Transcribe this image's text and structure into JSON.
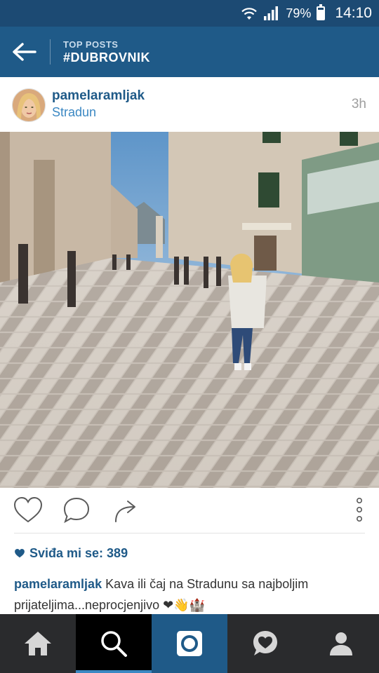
{
  "status_bar": {
    "battery": "79%",
    "battery_level": 0.79,
    "time": "14:10"
  },
  "header": {
    "subtitle": "TOP POSTS",
    "title": "#DUBROVNIK"
  },
  "post": {
    "username": "pamelaramljak",
    "location": "Stradun",
    "time_ago": "3h",
    "likes": "Sviđa mi se: 389",
    "caption_user": "pamelaramljak",
    "caption_text": " Kava ili čaj na Stradunu sa najboljim prijateljima...neprocjenjivo ❤👋🏰"
  },
  "tabs": [
    "home",
    "search",
    "camera",
    "activity",
    "profile"
  ],
  "colors": {
    "status_bar": "#1c4a73",
    "app_bar": "#1f5a88",
    "link": "#3b88c3",
    "tab_bar": "#2a2b2d"
  }
}
